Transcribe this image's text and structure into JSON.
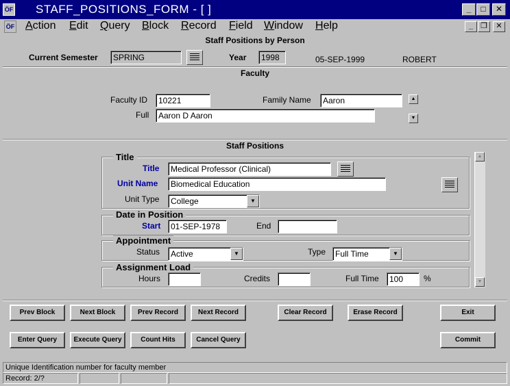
{
  "window": {
    "title": "STAFF_POSITIONS_FORM - [ ]",
    "app_icon": "oracle-forms-icon"
  },
  "menu": [
    "Action",
    "Edit",
    "Query",
    "Block",
    "Record",
    "Field",
    "Window",
    "Help"
  ],
  "form": {
    "heading": "Staff Positions by Person",
    "current_semester_label": "Current Semester",
    "current_semester": "SPRING",
    "year_label": "Year",
    "year": "1998",
    "date": "05-SEP-1999",
    "user": "ROBERT"
  },
  "faculty": {
    "heading": "Faculty",
    "faculty_id_label": "Faculty ID",
    "faculty_id": "10221",
    "family_name_label": "Family Name",
    "family_name": "Aaron",
    "full_label": "Full",
    "full_name": "Aaron D Aaron"
  },
  "staff_positions": {
    "heading": "Staff Positions",
    "title_section": "Title",
    "title_label": "Title",
    "title_value": "Medical Professor (Clinical)",
    "unit_name_label": "Unit Name",
    "unit_name": "Biomedical Education",
    "unit_type_label": "Unit Type",
    "unit_type": "College",
    "date_section": "Date in Position",
    "start_label": "Start",
    "start": "01-SEP-1978",
    "end_label": "End",
    "end": "",
    "appointment_section": "Appointment",
    "status_label": "Status",
    "status": "Active",
    "type_label": "Type",
    "type": "Full Time",
    "load_section": "Assignment Load",
    "hours_label": "Hours",
    "hours": "",
    "credits_label": "Credits",
    "credits": "",
    "full_time_label": "Full Time",
    "full_time": "100",
    "percent": "%"
  },
  "buttons": {
    "prev_block": "Prev Block",
    "next_block": "Next Block",
    "prev_record": "Prev Record",
    "next_record": "Next Record",
    "clear_record": "Clear Record",
    "erase_record": "Erase Record",
    "exit": "Exit",
    "enter_query": "Enter Query",
    "execute_query": "Execute Query",
    "count_hits": "Count Hits",
    "cancel_query": "Cancel Query",
    "commit": "Commit"
  },
  "status_bar": {
    "hint": "Unique Identification number for faculty member",
    "record": "Record: 2/?"
  }
}
